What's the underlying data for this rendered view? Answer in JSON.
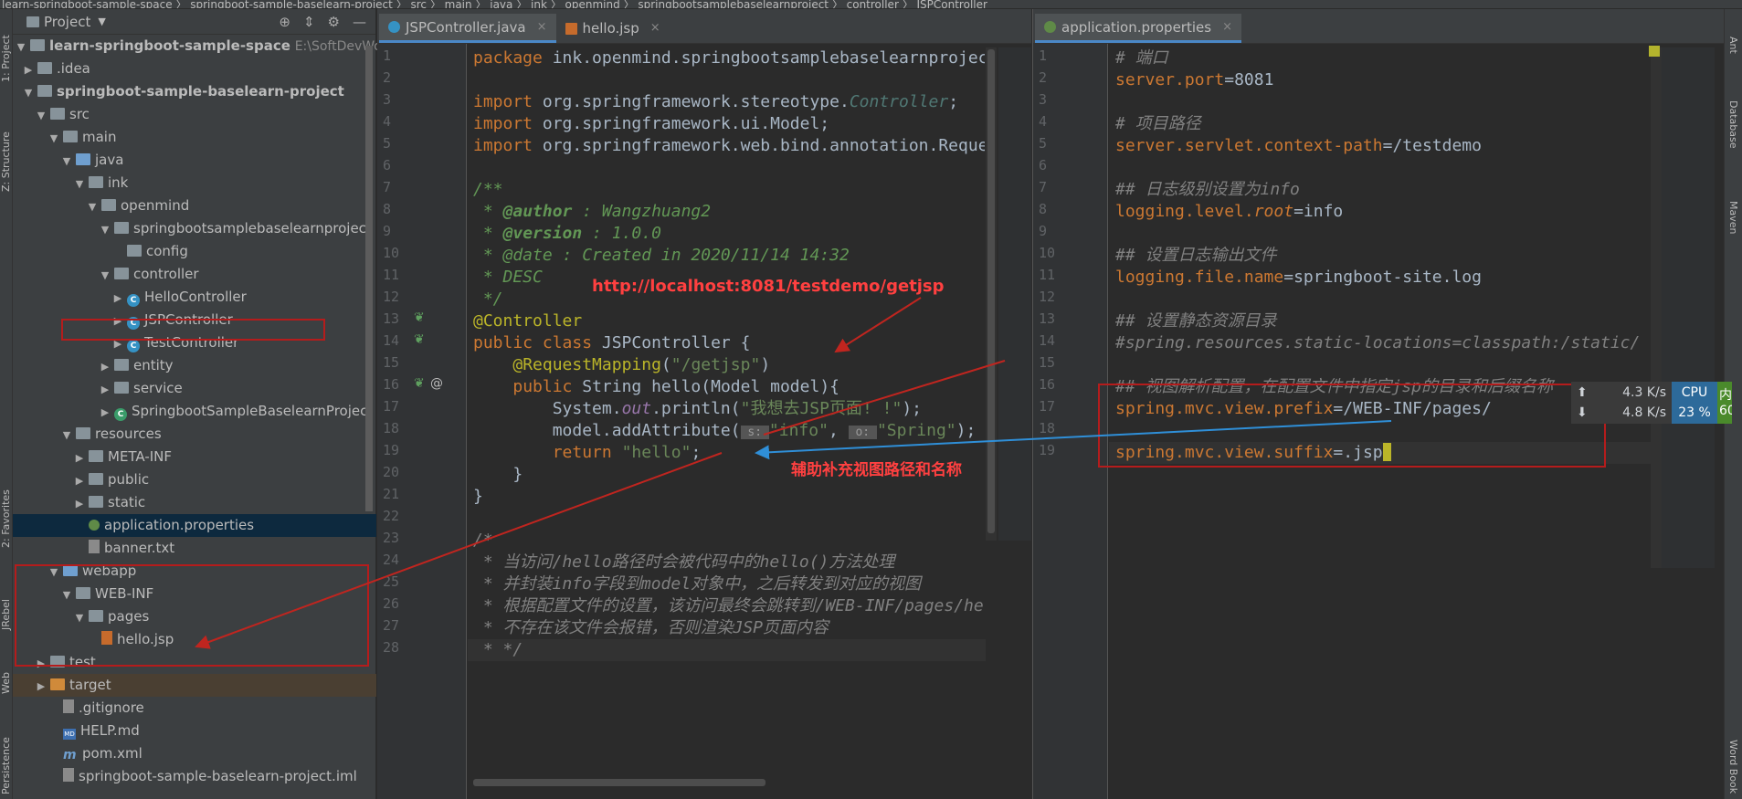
{
  "topbar": {
    "breadcrumb": "learn-springboot-sample-space  〉 springboot-sample-baselearn-project 〉 src 〉 main 〉 java 〉 ink 〉 openmind 〉 springbootsamplebaselearnproject 〉 controller 〉 JSPController"
  },
  "left_strip": {
    "tabs": [
      "1: Project",
      "Z: Structure",
      "2: Favorites",
      "JRebel",
      "Web",
      "Persistence"
    ]
  },
  "right_strip": {
    "tabs": [
      "Ant",
      "Database",
      "Maven",
      "Word Book"
    ]
  },
  "project_panel": {
    "title": "Project",
    "rows": [
      {
        "label": "learn-springboot-sample-space",
        "hint": "E:\\SoftDevWo"
      },
      {
        "label": ".idea"
      },
      {
        "label": "springboot-sample-baselearn-project"
      },
      {
        "label": "src"
      },
      {
        "label": "main"
      },
      {
        "label": "java"
      },
      {
        "label": "ink"
      },
      {
        "label": "openmind"
      },
      {
        "label": "springbootsamplebaselearnproject"
      },
      {
        "label": "config"
      },
      {
        "label": "controller"
      },
      {
        "label": "HelloController"
      },
      {
        "label": "JSPController"
      },
      {
        "label": "TestController"
      },
      {
        "label": "entity"
      },
      {
        "label": "service"
      },
      {
        "label": "SpringbootSampleBaselearnProject"
      },
      {
        "label": "resources"
      },
      {
        "label": "META-INF"
      },
      {
        "label": "public"
      },
      {
        "label": "static"
      },
      {
        "label": "application.properties"
      },
      {
        "label": "banner.txt"
      },
      {
        "label": "webapp"
      },
      {
        "label": "WEB-INF"
      },
      {
        "label": "pages"
      },
      {
        "label": "hello.jsp"
      },
      {
        "label": "test"
      },
      {
        "label": "target"
      },
      {
        "label": ".gitignore"
      },
      {
        "label": "HELP.md"
      },
      {
        "label": "pom.xml"
      },
      {
        "label": "springboot-sample-baselearn-project.iml"
      }
    ]
  },
  "editor_left": {
    "tabs": [
      {
        "label": "JSPController.java"
      },
      {
        "label": "hello.jsp"
      }
    ],
    "line_numbers": [
      "1",
      "2",
      "3",
      "4",
      "5",
      "6",
      "7",
      "8",
      "9",
      "10",
      "11",
      "12",
      "13",
      "14",
      "15",
      "16",
      "17",
      "18",
      "19",
      "20",
      "21",
      "22",
      "23",
      "24",
      "25",
      "26",
      "27",
      "28"
    ]
  },
  "editor_right": {
    "tabs": [
      {
        "label": "application.properties"
      }
    ],
    "line_numbers": [
      "1",
      "2",
      "3",
      "4",
      "5",
      "6",
      "7",
      "8",
      "9",
      "10",
      "11",
      "12",
      "13",
      "14",
      "15",
      "16",
      "17",
      "18",
      "19"
    ]
  },
  "annotations": {
    "url_label": "http://localhost:8081/testdemo/getjsp",
    "helper_label": "辅助补充视图路径和名称"
  },
  "net_widget": {
    "up": "4.3 K/s",
    "down": "4.8 K/s",
    "cpu_label": "CPU",
    "cpu_value": "23 %",
    "mem_label": "内",
    "mem_value": "60"
  },
  "colors": {
    "accent": "#4a88c7",
    "annotation_red": "#b51c1c",
    "annotation_blue": "#2f8fd8"
  }
}
